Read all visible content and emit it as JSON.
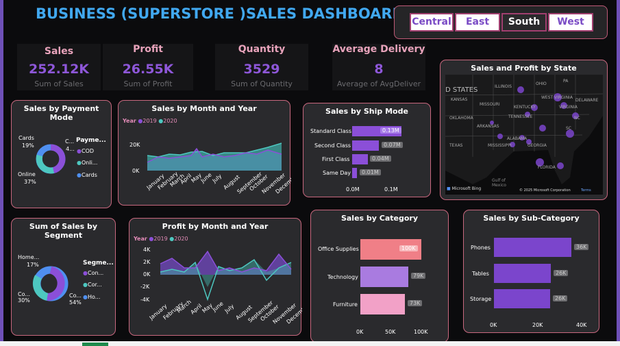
{
  "title": "BUSINESS (SUPERSTORE )SALES DASHBOARD",
  "region_slicer": {
    "options": [
      "Central",
      "East",
      "South",
      "West"
    ],
    "selected": "South"
  },
  "kpis": [
    {
      "label": "Sales",
      "value": "252.12K",
      "sub": "Sum of Sales"
    },
    {
      "label": "Profit",
      "value": "26.55K",
      "sub": "Sum of Profit"
    },
    {
      "label": "Quantity",
      "value": "3529",
      "sub": "Sum of Quantity"
    },
    {
      "label": "Average Delivery",
      "value": "8",
      "sub": "Average of AvgDeliver"
    }
  ],
  "payment_mode": {
    "title": "Sales by Payment Mode",
    "legend_title": "Payme...",
    "legend": [
      "COD",
      "Onli...",
      "Cards"
    ],
    "labels": {
      "cards": "Cards",
      "cards_pct": "19%",
      "online": "Online",
      "online_pct": "37%",
      "cod_short": "C...",
      "cod_pct_short": "4..."
    },
    "colors": [
      "#8b4fd8",
      "#4dc7c0",
      "#4f8ff0"
    ]
  },
  "month_sales": {
    "title": "Sales by Month and Year",
    "legend_title": "Year",
    "series_names": [
      "2019",
      "2020"
    ],
    "y_ticks": [
      "20K",
      "0K"
    ],
    "months": [
      "January",
      "February",
      "March",
      "April",
      "May",
      "June",
      "July",
      "August",
      "September",
      "October",
      "November",
      "December"
    ]
  },
  "ship_mode": {
    "title": "Sales by Ship Mode",
    "categories": [
      "Standard Class",
      "Second Class",
      "First Class",
      "Same Day"
    ],
    "value_labels": [
      "0.13M",
      "0.07M",
      "0.04M",
      "0.01M"
    ],
    "x_ticks": [
      "0.0M",
      "0.1M"
    ]
  },
  "map": {
    "title": "Sales and Profit by State",
    "labels": [
      "D STATES",
      "KANSAS",
      "ILLINOIS",
      "OHIO",
      "PA",
      "MISSOURI",
      "KENTUCKY",
      "WEST VIRGINIA",
      "DELAWARE",
      "OKLAHOMA",
      "TENNESSEE",
      "ARKANSAS",
      "SC",
      "TEXAS",
      "MISSISSIPPI",
      "ALABAMA",
      "GEORGIA",
      "FLORIDA",
      "Gulf of",
      "Mexico",
      "NC",
      "VIRGINIA"
    ],
    "brand": "Microsoft Bing",
    "copyright": "© 2025 Microsoft Corporation",
    "terms": "Terms"
  },
  "segment": {
    "title": "Sum of Sales by Segment",
    "legend_title": "Segme...",
    "legend": [
      "Con...",
      "Cor...",
      "Ho..."
    ],
    "labels": {
      "home": "Home...",
      "home_pct": "17%",
      "corp": "Co...",
      "corp_pct": "30%",
      "cons": "Co...",
      "cons_pct": "54%"
    },
    "colors": [
      "#8b4fd8",
      "#4dc7c0",
      "#4f8ff0"
    ]
  },
  "month_profit": {
    "title": "Profit by Month and Year",
    "legend_title": "Year",
    "series_names": [
      "2019",
      "2020"
    ],
    "y_ticks": [
      "4K",
      "2K",
      "0K",
      "-2K",
      "-4K"
    ],
    "months": [
      "January",
      "February",
      "March",
      "April",
      "May",
      "June",
      "July",
      "August",
      "September",
      "October",
      "November",
      "December"
    ]
  },
  "category": {
    "title": "Sales by Category",
    "categories": [
      "Office Supplies",
      "Technology",
      "Furniture"
    ],
    "value_labels": [
      "100K",
      "79K",
      "73K"
    ],
    "x_ticks": [
      "0K",
      "50K",
      "100K"
    ]
  },
  "subcategory": {
    "title": "Sales by Sub-Category",
    "categories": [
      "Phones",
      "Tables",
      "Storage"
    ],
    "value_labels": [
      "36K",
      "26K",
      "26K"
    ],
    "x_ticks": [
      "0K",
      "20K",
      "40K"
    ]
  },
  "colors": {
    "accent": "#8b4fd8",
    "teal": "#4dc7c0",
    "title": "#41a8f0",
    "pink": "#e8a3bb",
    "border": "#c9687f"
  }
}
